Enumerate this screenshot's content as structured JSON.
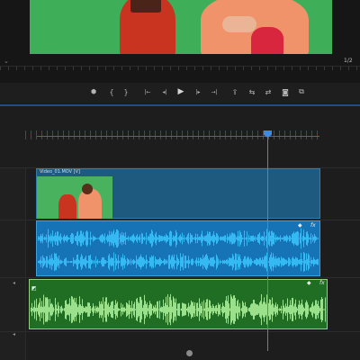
{
  "monitor": {
    "zoom_marker": "⌄",
    "resolution_fraction": "1/2"
  },
  "transport": {
    "buttons": [
      {
        "name": "add-marker-icon",
        "glyph": "⬢"
      },
      {
        "name": "mark-in-icon",
        "glyph": "{"
      },
      {
        "name": "mark-out-icon",
        "glyph": "}"
      },
      {
        "name": "go-to-in-icon",
        "glyph": "|←"
      },
      {
        "name": "step-back-icon",
        "glyph": "◂|"
      },
      {
        "name": "play-icon",
        "glyph": "▶"
      },
      {
        "name": "step-forward-icon",
        "glyph": "|▸"
      },
      {
        "name": "go-to-out-icon",
        "glyph": "→|"
      },
      {
        "name": "lift-icon",
        "glyph": "⇪"
      },
      {
        "name": "extract-icon",
        "glyph": "⇆"
      },
      {
        "name": "insert-icon",
        "glyph": "⇄"
      },
      {
        "name": "export-frame-icon",
        "glyph": "◙"
      },
      {
        "name": "compare-view-icon",
        "glyph": "⧉"
      }
    ]
  },
  "timeline": {
    "video_clip_label": "Video_01.MOV [V]",
    "fx_badge": "fx",
    "colors": {
      "video_clip": "#1e5a80",
      "audio_a1": "#1673b6",
      "audio_a1_wave": "#35b9f2",
      "audio_a2": "#1f6e23",
      "audio_a2_wave": "#9be08a",
      "playhead": "#3d8be0",
      "work_bar": "#c23b3b"
    }
  }
}
